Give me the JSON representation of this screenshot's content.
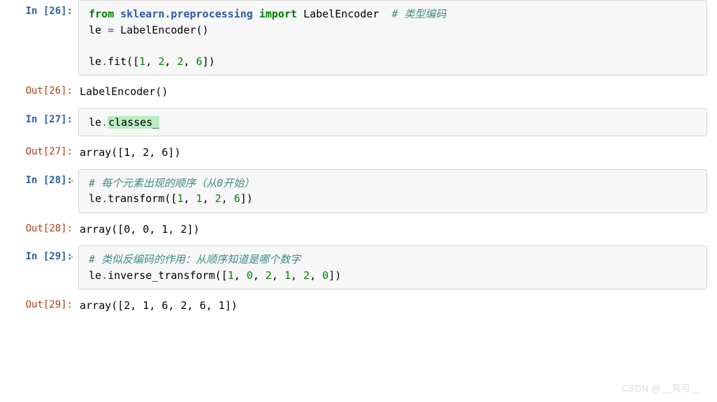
{
  "cells": {
    "c26_prompt": "In [26]:",
    "c26_out_prompt": "Out[26]:",
    "c26_code_kw1": "from",
    "c26_code_mod": "sklearn.preprocessing",
    "c26_code_kw2": "import",
    "c26_code_cls": "LabelEncoder",
    "c26_code_cm1": "# 类型编码",
    "c26_code_line2_pre": "le ",
    "c26_code_line2_op": "=",
    "c26_code_line2_ctor": " LabelEncoder()",
    "c26_code_line4_pre": "le",
    "c26_code_line4_dot": ".",
    "c26_code_line4_fit": "fit([",
    "c26_code_line4_n1": "1",
    "c26_code_line4_c1": ", ",
    "c26_code_line4_n2": "2",
    "c26_code_line4_c2": ", ",
    "c26_code_line4_n3": "2",
    "c26_code_line4_c3": ", ",
    "c26_code_line4_n4": "6",
    "c26_code_line4_close": "])",
    "c26_out": "LabelEncoder()",
    "c27_prompt": "In [27]:",
    "c27_out_prompt": "Out[27]:",
    "c27_code_pre": "le",
    "c27_code_dot": ".",
    "c27_code_attr": "classes_",
    "c27_out": "array([1, 2, 6])",
    "c28_prompt": "In [28]:",
    "c28_out_prompt": "Out[28]:",
    "c28_cm": "# 每个元素出现的顺序（从0开始）",
    "c28_l2_pre": "le",
    "c28_l2_dot": ".",
    "c28_l2_fn": "transform([",
    "c28_l2_n1": "1",
    "c28_l2_c1": ", ",
    "c28_l2_n2": "1",
    "c28_l2_c2": ", ",
    "c28_l2_n3": "2",
    "c28_l2_c3": ", ",
    "c28_l2_n4": "6",
    "c28_l2_close": "])",
    "c28_out": "array([0, 0, 1, 2])",
    "c29_prompt": "In [29]:",
    "c29_out_prompt": "Out[29]:",
    "c29_cm": "# 类似反编码的作用：从顺序知道是哪个数字",
    "c29_l2_pre": "le",
    "c29_l2_dot": ".",
    "c29_l2_fn": "inverse_transform([",
    "c29_l2_n1": "1",
    "c29_l2_c1": ", ",
    "c29_l2_n2": "0",
    "c29_l2_c2": ", ",
    "c29_l2_n3": "2",
    "c29_l2_c3": ", ",
    "c29_l2_n4": "1",
    "c29_l2_c4": ", ",
    "c29_l2_n5": "2",
    "c29_l2_c5": ", ",
    "c29_l2_n6": "0",
    "c29_l2_close": "])",
    "c29_out": "array([2, 1, 6, 2, 6, 1])"
  },
  "watermark": "CSDN @__弯弓__"
}
